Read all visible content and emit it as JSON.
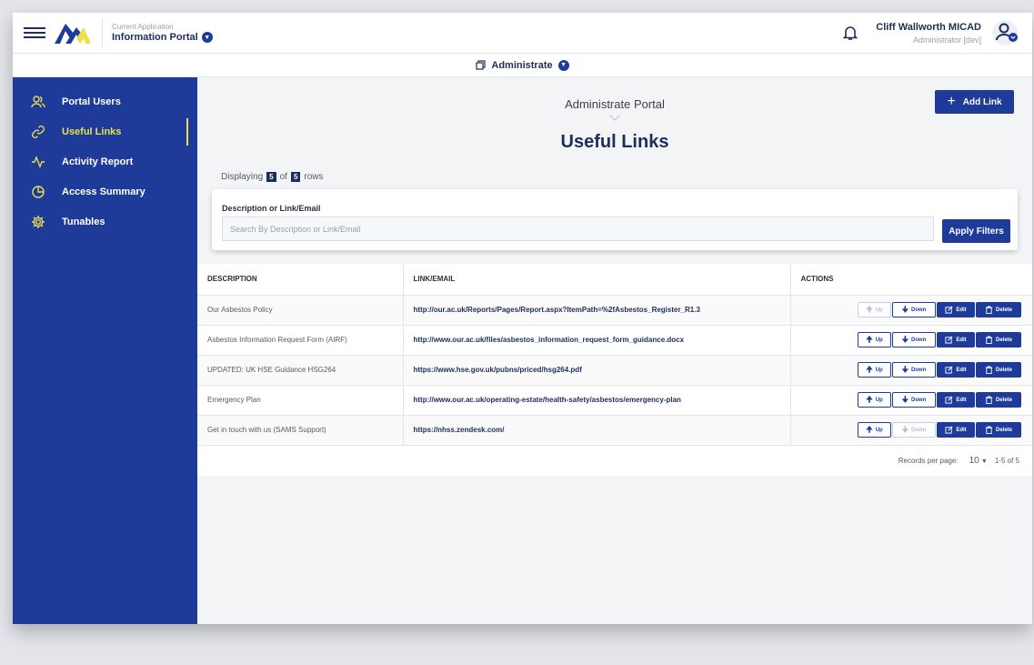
{
  "header": {
    "app_caption": "Current Application",
    "app_name": "Information Portal",
    "user_name": "Cliff Wallworth MICAD",
    "user_role": "Administrator [dev]"
  },
  "subheader": {
    "label": "Administrate"
  },
  "sidebar": {
    "items": [
      {
        "label": "Portal Users",
        "icon": "users-icon"
      },
      {
        "label": "Useful Links",
        "icon": "link-icon",
        "active": true
      },
      {
        "label": "Activity Report",
        "icon": "activity-icon"
      },
      {
        "label": "Access Summary",
        "icon": "pie-chart-icon"
      },
      {
        "label": "Tunables",
        "icon": "gear-icon"
      }
    ]
  },
  "page": {
    "breadcrumb": "Administrate Portal",
    "title": "Useful Links",
    "add_button": "Add Link",
    "displaying_prefix": "Displaying",
    "displaying_count": "5",
    "displaying_of": "of",
    "displaying_total": "5",
    "displaying_suffix": "rows"
  },
  "filter": {
    "label": "Description or Link/Email",
    "placeholder": "Search By Description or Link/Email",
    "apply_button": "Apply Filters"
  },
  "table": {
    "headers": [
      "DESCRIPTION",
      "LINK/EMAIL",
      "ACTIONS"
    ],
    "rows": [
      {
        "description": "Our Asbestos Policy",
        "link": "http://our.ac.uk/Reports/Pages/Report.aspx?ItemPath=%2fAsbestos_Register_R1.3",
        "up_disabled": true,
        "down_disabled": false
      },
      {
        "description": "Asbestos Information Request Form (AIRF)",
        "link": "http://www.our.ac.uk/files/asbestos_information_request_form_guidance.docx",
        "up_disabled": false,
        "down_disabled": false
      },
      {
        "description": "UPDATED: UK HSE Guidance HSG264",
        "link": "https://www.hse.gov.uk/pubns/priced/hsg264.pdf",
        "up_disabled": false,
        "down_disabled": false
      },
      {
        "description": "Emergency Plan",
        "link": "http://www.our.ac.uk/operating-estate/health-safety/asbestos/emergency-plan",
        "up_disabled": false,
        "down_disabled": false
      },
      {
        "description": "Get in touch with us (SAMS Support)",
        "link": "https://nhss.zendesk.com/",
        "up_disabled": false,
        "down_disabled": true
      }
    ],
    "action_labels": {
      "up": "Up",
      "down": "Down",
      "edit": "Edit",
      "delete": "Delete"
    }
  },
  "pager": {
    "records_label": "Records per page:",
    "records_value": "10",
    "range": "1-5 of 5"
  },
  "colors": {
    "primary": "#1f3b9a",
    "accent": "#e9e04a",
    "navy": "#1d2d5c"
  }
}
